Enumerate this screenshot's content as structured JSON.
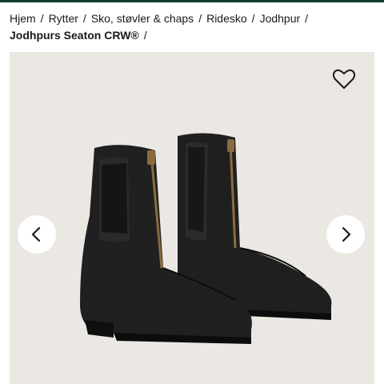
{
  "breadcrumb": {
    "items": [
      "Hjem",
      "Rytter",
      "Sko, støvler & chaps",
      "Ridesko",
      "Jodhpur"
    ],
    "current": "Jodhpurs Seaton CRW®",
    "separator": "/"
  },
  "product": {
    "image_alt": "Jodhpurs Seaton CRW® black zip paddock boots",
    "favorite_icon": "heart-outline-icon",
    "prev_icon": "chevron-left-icon",
    "next_icon": "chevron-right-icon"
  },
  "colors": {
    "gallery_bg": "#ebe7e2",
    "accent_strip": "#0f3d2a",
    "boot": "#1c1c1c",
    "zip": "#8a6a3e"
  }
}
